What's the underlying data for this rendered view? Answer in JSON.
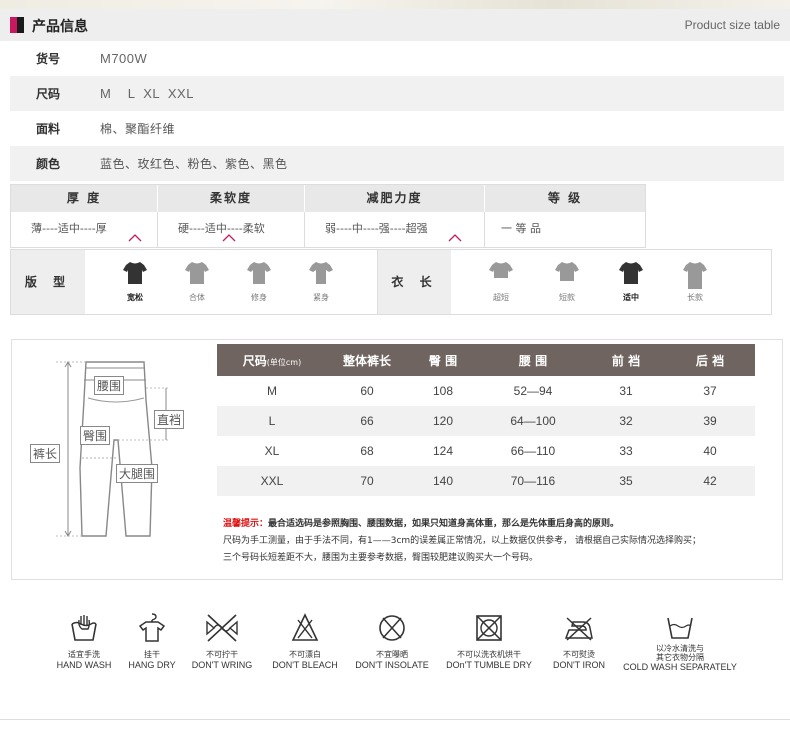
{
  "header": {
    "title": "产品信息",
    "subtitle": "Product size table"
  },
  "info": {
    "rows": [
      {
        "label": "货号",
        "value": "M700W"
      },
      {
        "label": "尺码",
        "value": "M    L  XL  XXL"
      },
      {
        "label": "面料",
        "value": "棉、聚酯纤维"
      },
      {
        "label": "颜色",
        "value": "蓝色、玫红色、粉色、紫色、黑色"
      }
    ]
  },
  "attributes": {
    "headers": [
      "厚 度",
      "柔软度",
      "减肥力度",
      "等 级"
    ],
    "values": [
      "薄----适中----厚",
      "硬----适中----柔软",
      "弱----中----强----超强",
      "一 等 品"
    ],
    "selected": [
      "适中",
      "适中",
      "超强",
      "一等品"
    ]
  },
  "fit": {
    "label": "版 型",
    "options": [
      "宽松",
      "合体",
      "修身",
      "紧身"
    ],
    "selected": "宽松"
  },
  "length": {
    "label": "衣 长",
    "options": [
      "超短",
      "短款",
      "适中",
      "长款"
    ],
    "selected": "适中"
  },
  "diagram": {
    "labels": {
      "waist": "腰围",
      "rise": "直裆",
      "hip": "臀围",
      "length": "裤长",
      "thigh": "大腿围"
    }
  },
  "size_table": {
    "headers": [
      "尺码",
      "整体裤长",
      "臀 围",
      "腰 围",
      "前 裆",
      "后 裆"
    ],
    "header_unit": "(单位cm)",
    "rows": [
      [
        "M",
        "60",
        "108",
        "52—94",
        "31",
        "37"
      ],
      [
        "L",
        "66",
        "120",
        "64—100",
        "32",
        "39"
      ],
      [
        "XL",
        "68",
        "124",
        "66—110",
        "33",
        "40"
      ],
      [
        "XXL",
        "70",
        "140",
        "70—116",
        "35",
        "42"
      ]
    ]
  },
  "notes": {
    "warn_label": "温馨提示：",
    "line1": "最合适选码是参照胸围、腰围数据，如果只知道身高体重，那么是先体重后身高的原则。",
    "line2": "尺码为手工测量，由于手法不同，有1——3cm的误差属正常情况，以上数据仅供参考，  请根据自己实际情况选择购买；",
    "line3": "三个号码长短差距不大，腰围为主要参考数据，臀围较肥建议购买大一个号码。"
  },
  "care": [
    {
      "icon": "hand-wash-icon",
      "zh": "适宜手洗",
      "en": "HAND WASH"
    },
    {
      "icon": "hang-dry-icon",
      "zh": "挂干",
      "en": "HANG DRY"
    },
    {
      "icon": "no-wring-icon",
      "zh": "不可拧干",
      "en": "DON'T WRING"
    },
    {
      "icon": "no-bleach-icon",
      "zh": "不可漂白",
      "en": "DON'T BLEACH"
    },
    {
      "icon": "no-insolate-icon",
      "zh": "不宜曝晒",
      "en": "DON'T INSOLATE"
    },
    {
      "icon": "no-tumble-dry-icon",
      "zh": "不可以洗衣机烘干",
      "en": "DOn'T TUMBLE DRY"
    },
    {
      "icon": "no-iron-icon",
      "zh": "不可熨烫",
      "en": "DON'T IRON"
    },
    {
      "icon": "cold-wash-icon",
      "zh": "以冷水清洗与\n其它衣物分隔",
      "en": "COLD WASH SEPARATELY"
    }
  ],
  "colors": {
    "accent": "#c8185e",
    "table_header": "#6f6460",
    "selected_shirt": "#333333",
    "unselected_shirt": "#999999",
    "caret": "#c8185e"
  }
}
